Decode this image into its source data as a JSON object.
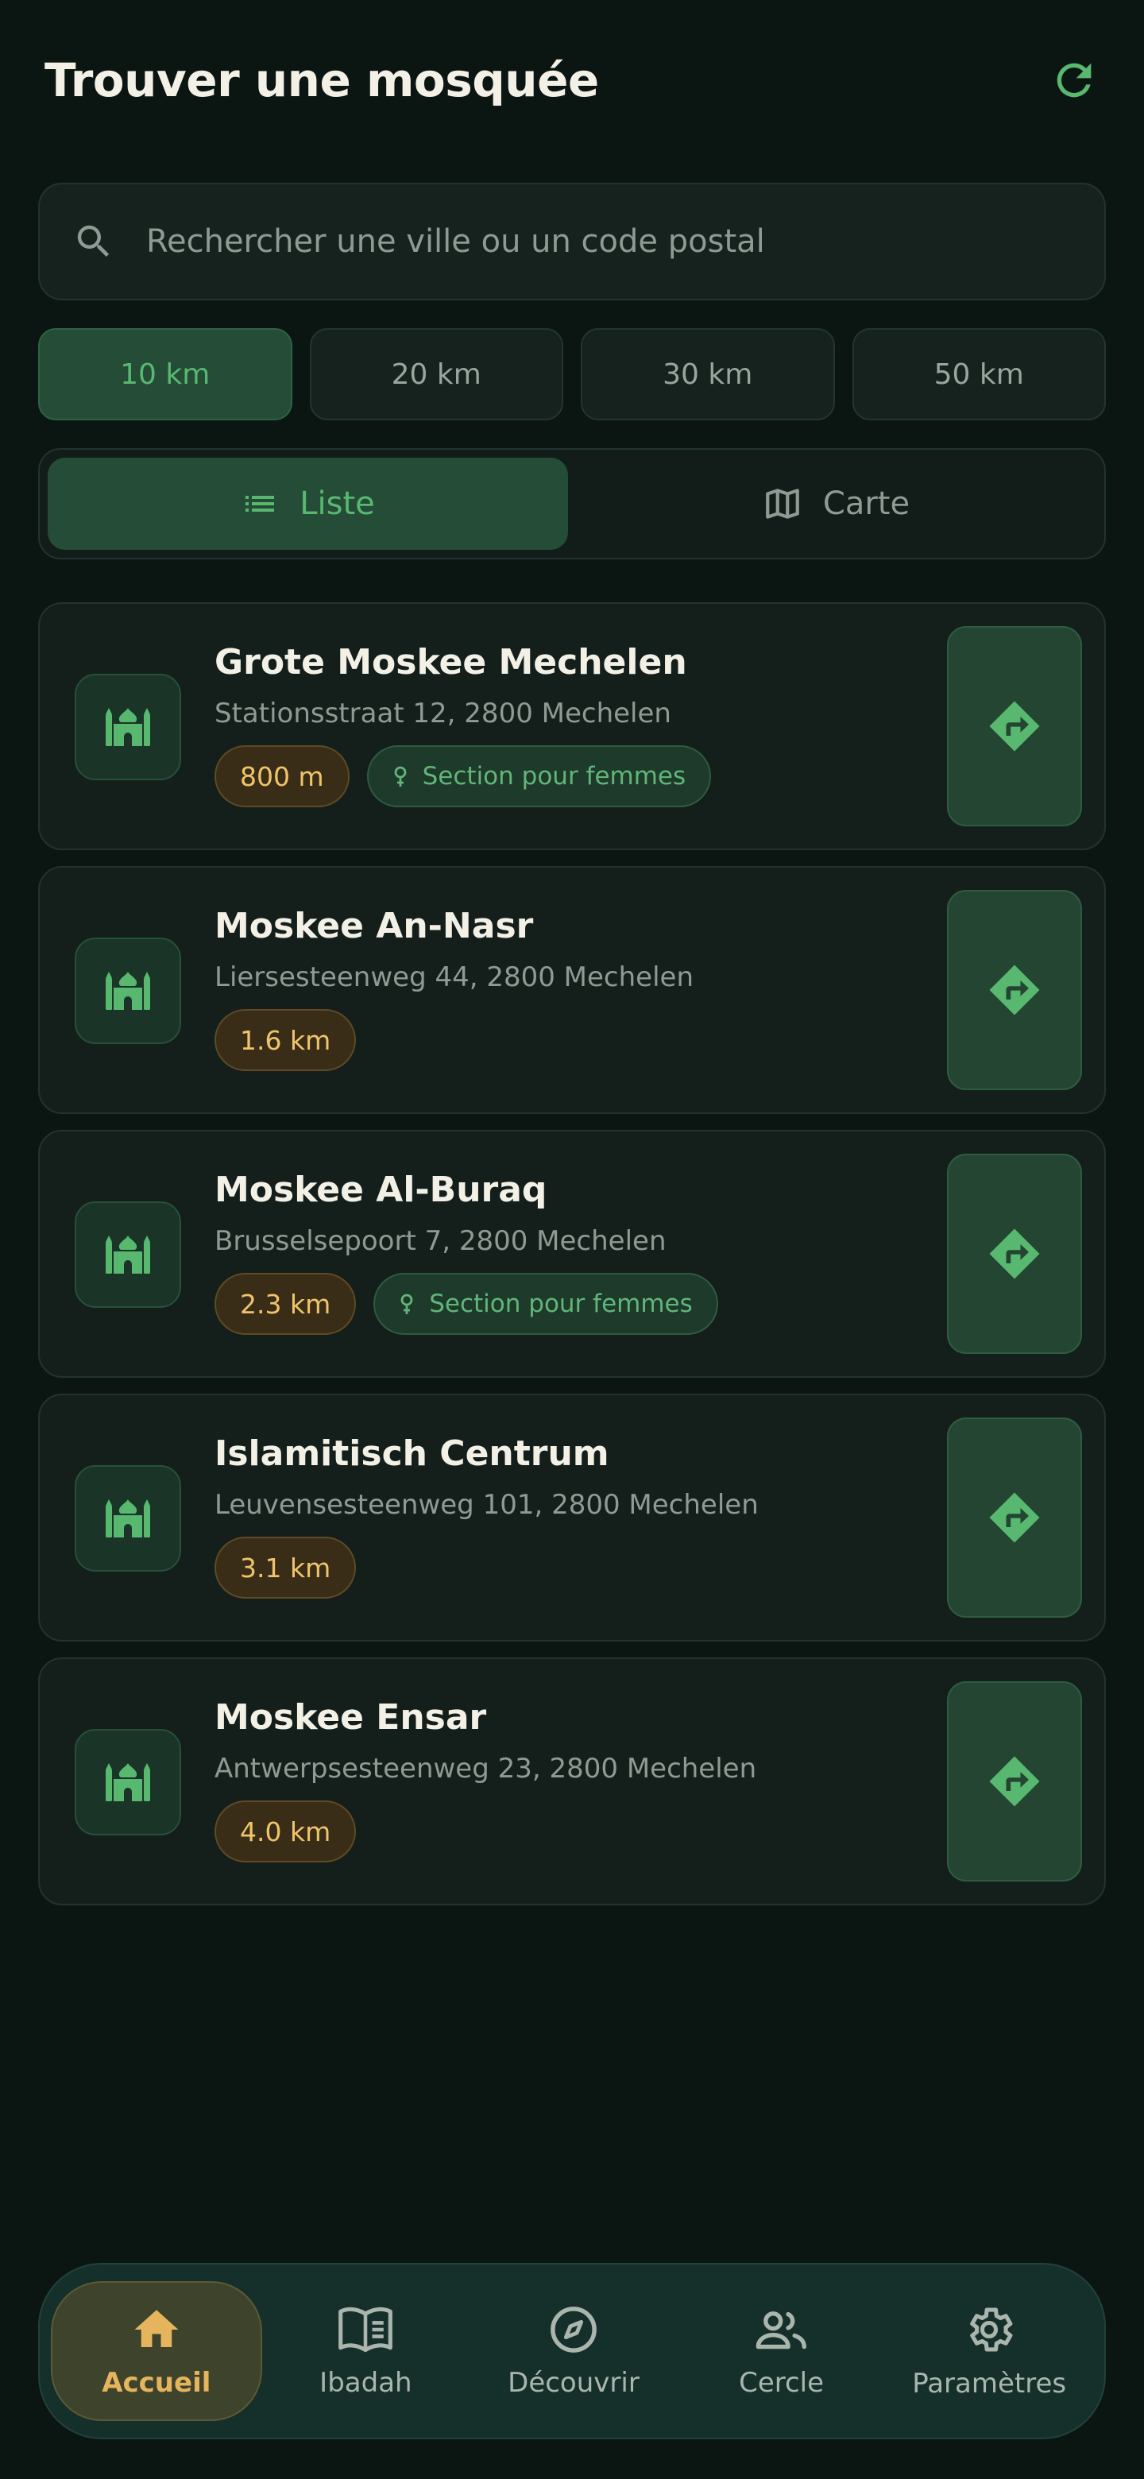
{
  "header": {
    "title": "Trouver une mosquée"
  },
  "search": {
    "placeholder": "Rechercher une ville ou un code postal",
    "value": ""
  },
  "radius": {
    "options": [
      {
        "label": "10 km",
        "active": true
      },
      {
        "label": "20 km",
        "active": false
      },
      {
        "label": "30 km",
        "active": false
      },
      {
        "label": "50 km",
        "active": false
      }
    ]
  },
  "view_toggle": {
    "list_label": "Liste",
    "map_label": "Carte",
    "selected": "Liste"
  },
  "mosques": [
    {
      "name": "Grote Moskee Mechelen",
      "address": "Stationsstraat 12, 2800 Mechelen",
      "distance": "800 m",
      "women_section": "Section pour femmes"
    },
    {
      "name": "Moskee An-Nasr",
      "address": "Liersesteenweg 44, 2800 Mechelen",
      "distance": "1.6 km",
      "women_section": null
    },
    {
      "name": "Moskee Al-Buraq",
      "address": "Brusselsepoort 7, 2800 Mechelen",
      "distance": "2.3 km",
      "women_section": "Section pour femmes"
    },
    {
      "name": "Islamitisch Centrum",
      "address": "Leuvensesteenweg 101, 2800 Mechelen",
      "distance": "3.1 km",
      "women_section": null
    },
    {
      "name": "Moskee Ensar",
      "address": "Antwerpsesteenweg 23, 2800 Mechelen",
      "distance": "4.0 km",
      "women_section": null
    }
  ],
  "bottom_nav": {
    "items": [
      {
        "label": "Accueil",
        "icon": "home-icon",
        "active": true
      },
      {
        "label": "Ibadah",
        "icon": "book-icon",
        "active": false
      },
      {
        "label": "Découvrir",
        "icon": "compass-icon",
        "active": false
      },
      {
        "label": "Cercle",
        "icon": "people-icon",
        "active": false
      },
      {
        "label": "Paramètres",
        "icon": "gear-icon",
        "active": false
      }
    ]
  },
  "colors": {
    "background": "#0b1613",
    "accent_green": "#58b870",
    "accent_gold": "#e7b45e",
    "distance_text": "#f0c46c"
  }
}
